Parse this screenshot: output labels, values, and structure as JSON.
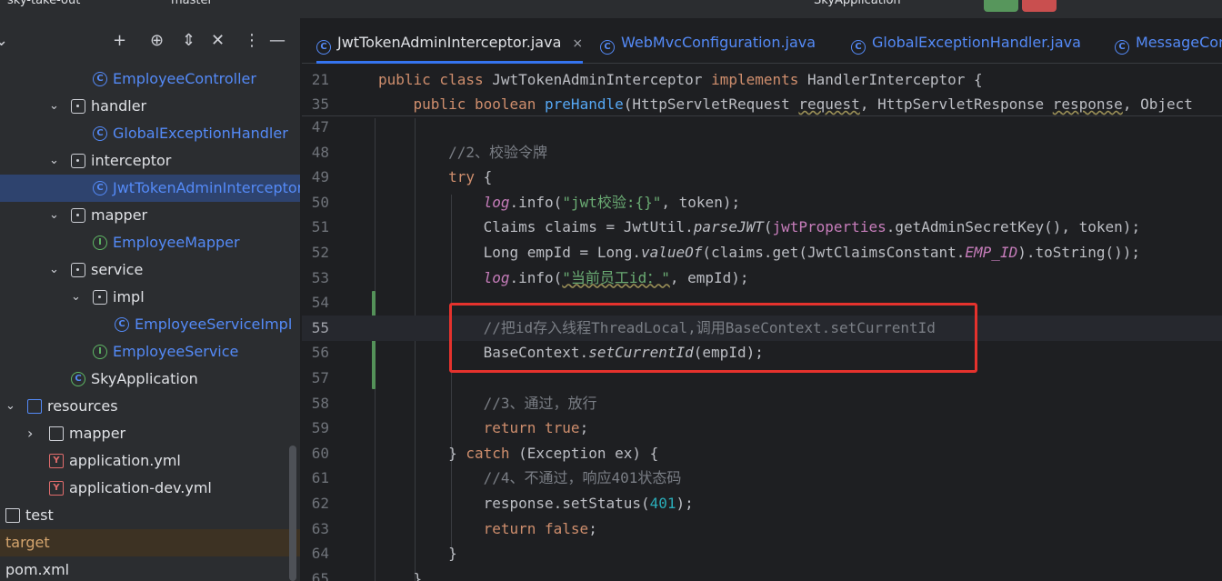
{
  "title_bar": {
    "project": "sky-take-out",
    "branch": "master",
    "run_config": "SkyApplication"
  },
  "project_panel": {
    "toolbar_icons": [
      "add-icon",
      "target-icon",
      "expand-icon",
      "collapse-icon",
      "more-icon",
      "minimize-icon"
    ],
    "tree": [
      {
        "label": "EmployeeController",
        "type": "class"
      },
      {
        "label": "handler",
        "type": "package",
        "expanded": true
      },
      {
        "label": "GlobalExceptionHandler",
        "type": "class"
      },
      {
        "label": "interceptor",
        "type": "package",
        "expanded": true
      },
      {
        "label": "JwtTokenAdminInterceptor",
        "type": "class",
        "selected": true
      },
      {
        "label": "mapper",
        "type": "package",
        "expanded": true
      },
      {
        "label": "EmployeeMapper",
        "type": "interface"
      },
      {
        "label": "service",
        "type": "package",
        "expanded": true
      },
      {
        "label": "impl",
        "type": "package",
        "expanded": true
      },
      {
        "label": "EmployeeServiceImpl",
        "type": "class"
      },
      {
        "label": "EmployeeService",
        "type": "interface"
      },
      {
        "label": "SkyApplication",
        "type": "spring-class"
      },
      {
        "label": "resources",
        "type": "resources-folder",
        "expanded": true
      },
      {
        "label": "mapper",
        "type": "folder",
        "expanded": false
      },
      {
        "label": "application.yml",
        "type": "yaml"
      },
      {
        "label": "application-dev.yml",
        "type": "yaml"
      },
      {
        "label": "test",
        "type": "folder"
      },
      {
        "label": "target",
        "type": "excluded"
      },
      {
        "label": "pom.xml",
        "type": "file"
      }
    ]
  },
  "editor": {
    "tabs": [
      {
        "label": "JwtTokenAdminInterceptor.java",
        "active": true,
        "close": "×"
      },
      {
        "label": "WebMvcConfiguration.java",
        "active": false
      },
      {
        "label": "GlobalExceptionHandler.java",
        "active": false
      },
      {
        "label": "MessageCon",
        "active": false
      }
    ],
    "sticky_lines": [
      {
        "num": "21",
        "tokens": [
          [
            "kw",
            "public class "
          ],
          [
            "tx",
            "JwtTokenAdminInterceptor "
          ],
          [
            "kw",
            "implements "
          ],
          [
            "tx",
            "HandlerInterceptor {"
          ]
        ]
      },
      {
        "num": "35",
        "tokens": [
          [
            "tx",
            "    "
          ],
          [
            "kw",
            "public boolean "
          ],
          [
            "fn",
            "preHandle"
          ],
          [
            "tx",
            "(HttpServletRequest "
          ],
          [
            "tx ul",
            "request"
          ],
          [
            "tx",
            ", HttpServletResponse "
          ],
          [
            "tx ul",
            "response"
          ],
          [
            "tx",
            ", Object"
          ]
        ]
      }
    ],
    "lines": [
      {
        "num": "47",
        "tokens": []
      },
      {
        "num": "48",
        "tokens": [
          [
            "tx",
            "        "
          ],
          [
            "cm",
            "//2、校验令牌"
          ]
        ]
      },
      {
        "num": "49",
        "tokens": [
          [
            "tx",
            "        "
          ],
          [
            "kw",
            "try "
          ],
          [
            "tx",
            "{"
          ]
        ]
      },
      {
        "num": "50",
        "tokens": [
          [
            "tx",
            "            "
          ],
          [
            "stf",
            "log"
          ],
          [
            "tx",
            "."
          ],
          [
            "tx",
            "info("
          ],
          [
            "str",
            "\"jwt校验:{}\""
          ],
          [
            "tx",
            ", token);"
          ]
        ]
      },
      {
        "num": "51",
        "tokens": [
          [
            "tx",
            "            Claims claims = JwtUtil."
          ],
          [
            "tx st",
            "parseJWT"
          ],
          [
            "tx",
            "("
          ],
          [
            "fld",
            "jwtProperties"
          ],
          [
            "tx",
            ".getAdminSecretKey(), token);"
          ]
        ]
      },
      {
        "num": "52",
        "tokens": [
          [
            "tx",
            "            Long empId = Long."
          ],
          [
            "tx st",
            "valueOf"
          ],
          [
            "tx",
            "(claims.get(JwtClaimsConstant."
          ],
          [
            "stf",
            "EMP_ID"
          ],
          [
            "tx",
            ").toString());"
          ]
        ]
      },
      {
        "num": "53",
        "tokens": [
          [
            "tx",
            "            "
          ],
          [
            "stf",
            "log"
          ],
          [
            "tx",
            ".info("
          ],
          [
            "str ul-str",
            "\"当前员工id：\""
          ],
          [
            "tx",
            ", empId);"
          ]
        ]
      },
      {
        "num": "54",
        "tokens": []
      },
      {
        "num": "55",
        "tokens": [
          [
            "tx",
            "            "
          ],
          [
            "cm",
            "//把id存入线程ThreadLocal,调用BaseContext.setCurrentId"
          ]
        ],
        "current": true
      },
      {
        "num": "56",
        "tokens": [
          [
            "tx",
            "            BaseContext."
          ],
          [
            "tx st",
            "setCurrentId"
          ],
          [
            "tx",
            "(empId);"
          ]
        ]
      },
      {
        "num": "57",
        "tokens": []
      },
      {
        "num": "58",
        "tokens": [
          [
            "tx",
            "            "
          ],
          [
            "cm",
            "//3、通过，放行"
          ]
        ]
      },
      {
        "num": "59",
        "tokens": [
          [
            "tx",
            "            "
          ],
          [
            "kw",
            "return true"
          ],
          [
            "tx",
            ";"
          ]
        ]
      },
      {
        "num": "60",
        "tokens": [
          [
            "tx",
            "        } "
          ],
          [
            "kw",
            "catch "
          ],
          [
            "tx",
            "(Exception ex) {"
          ]
        ]
      },
      {
        "num": "61",
        "tokens": [
          [
            "tx",
            "            "
          ],
          [
            "cm",
            "//4、不通过，响应401状态码"
          ]
        ]
      },
      {
        "num": "62",
        "tokens": [
          [
            "tx",
            "            response.setStatus("
          ],
          [
            "num",
            "401"
          ],
          [
            "tx",
            ");"
          ]
        ]
      },
      {
        "num": "63",
        "tokens": [
          [
            "tx",
            "            "
          ],
          [
            "kw",
            "return false"
          ],
          [
            "tx",
            ";"
          ]
        ]
      },
      {
        "num": "64",
        "tokens": [
          [
            "tx",
            "        }"
          ]
        ]
      },
      {
        "num": "65",
        "tokens": [
          [
            "tx",
            "    }"
          ]
        ]
      }
    ]
  },
  "colors": {
    "panel_bg": "#2b2d30",
    "editor_bg": "#1e1f22",
    "selection": "#2e436e",
    "keyword": "#cf8e6d",
    "string": "#6aab73",
    "comment": "#7a7e85",
    "highlight_box": "#e5322d"
  }
}
